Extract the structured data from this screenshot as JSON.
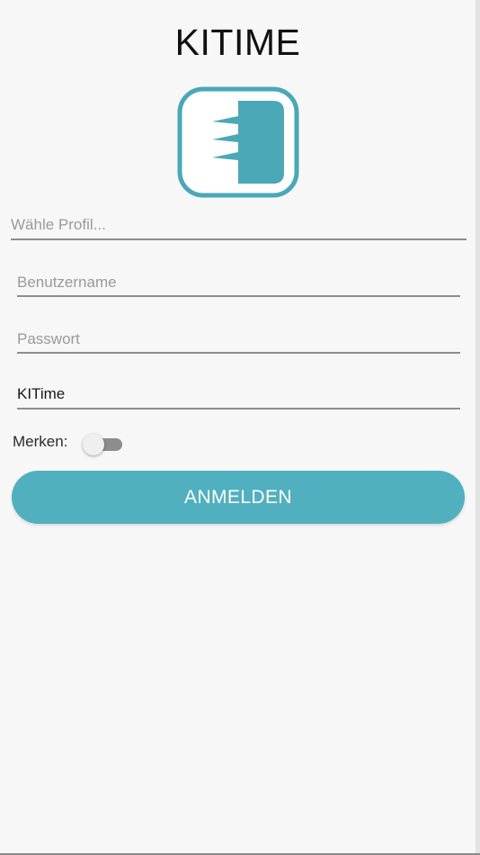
{
  "app": {
    "title": "KITIME"
  },
  "form": {
    "profile_placeholder": "Wähle Profil...",
    "username_placeholder": "Benutzername",
    "password_placeholder": "Passwort",
    "tenant_value": "KITime",
    "remember_label": "Merken:",
    "remember_on": false,
    "login_label": "ANMELDEN"
  },
  "icons": {
    "logo": "kitime-logo-icon",
    "chevron": "dropdown-icon"
  },
  "colors": {
    "accent": "#51b0bf",
    "background": "#f7f7f7",
    "underline": "#8e8e8e"
  }
}
